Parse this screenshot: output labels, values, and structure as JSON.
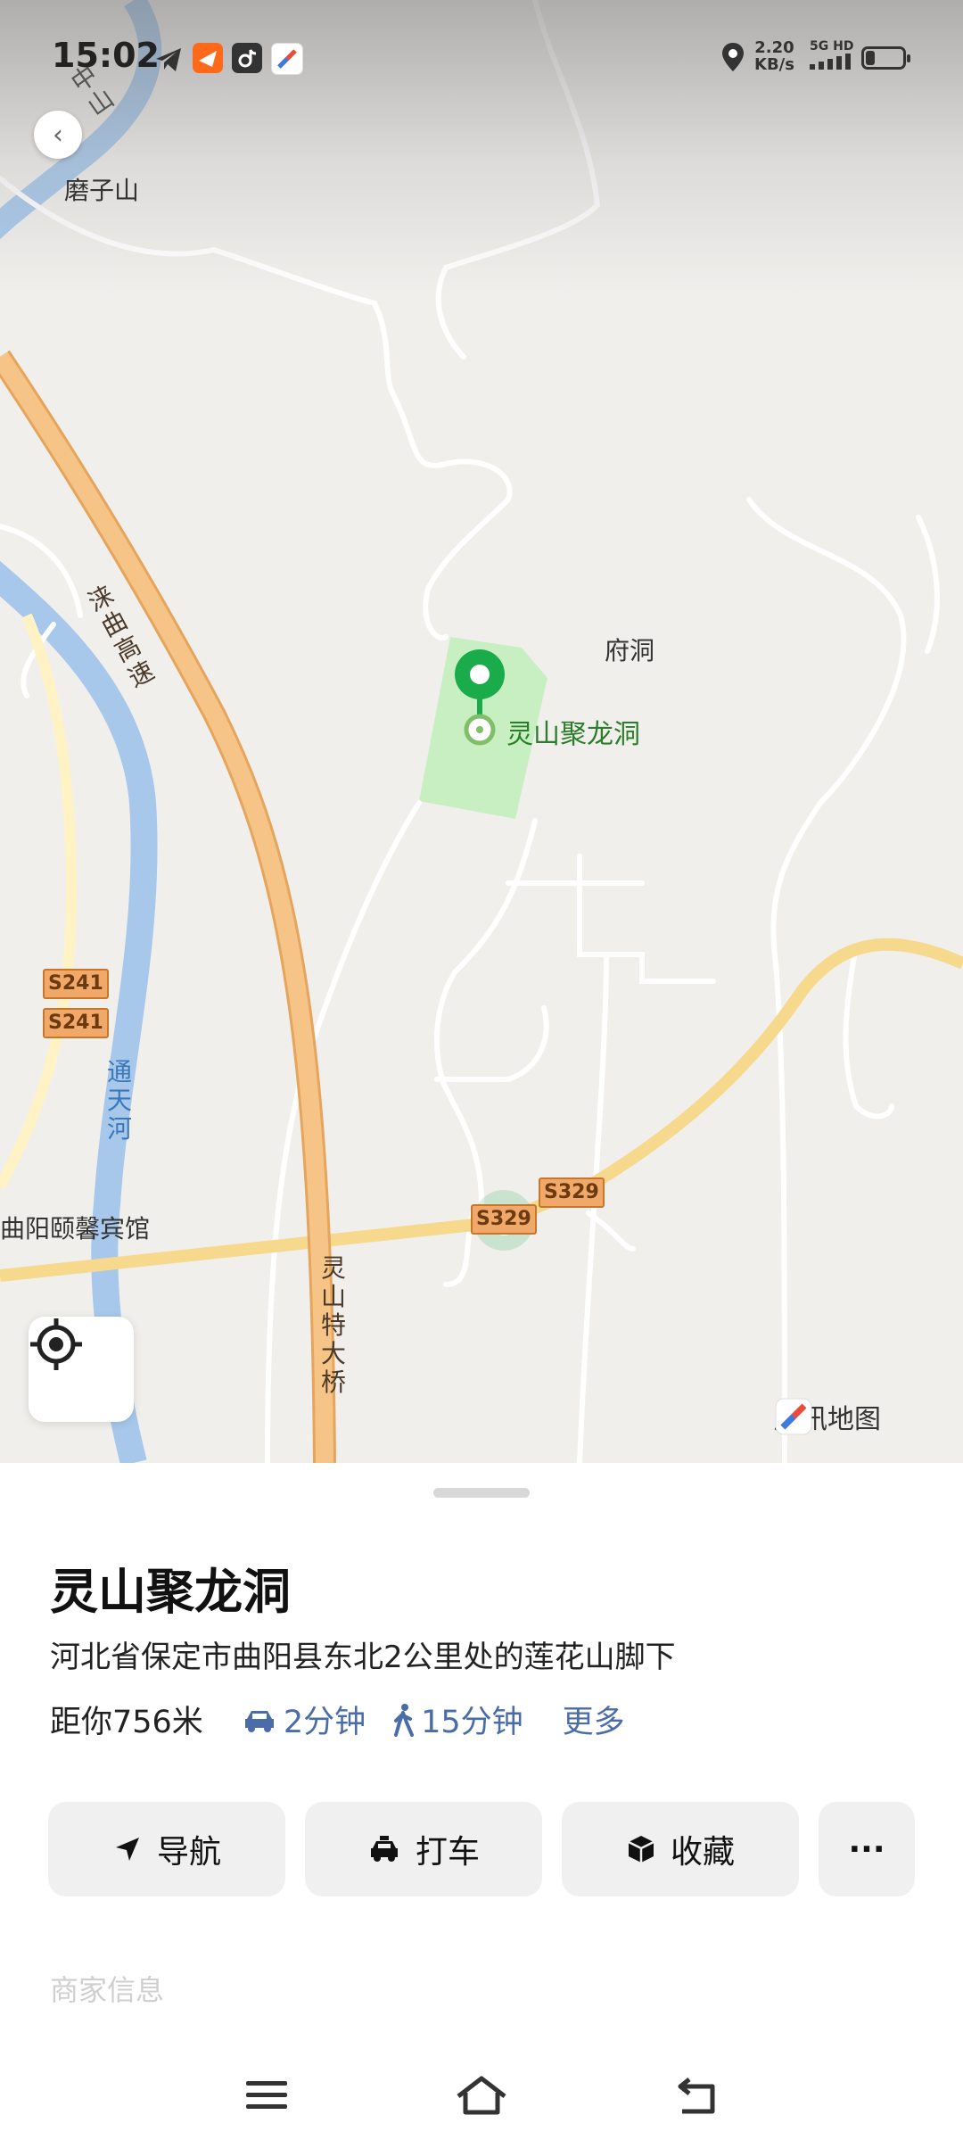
{
  "status_bar": {
    "time": "15:02",
    "speed_value": "2.20",
    "speed_unit": "KB/s",
    "network": "5G HD",
    "battery_level": 0.25
  },
  "map": {
    "labels": {
      "mozishan": "磨子山",
      "fudong": "府洞",
      "poi": "灵山聚龙洞",
      "hotel": "曲阳颐馨宾馆",
      "expressway": "涞曲高速",
      "river": "通天河",
      "bridge": "灵山特大桥",
      "road_top": "中山"
    },
    "shields": {
      "s241_a": "S241",
      "s241_b": "S241",
      "s329_a": "S329",
      "s329_b": "S329"
    },
    "watermark": "腾讯地图"
  },
  "place": {
    "name": "灵山聚龙洞",
    "address": "河北省保定市曲阳县东北2公里处的莲花山脚下",
    "distance": "距你756米",
    "drive_time": "2分钟",
    "walk_time": "15分钟",
    "more": "更多"
  },
  "actions": {
    "navigate": "导航",
    "taxi": "打车",
    "favorite": "收藏",
    "more": "···"
  },
  "section_hint": "商家信息",
  "colors": {
    "accent": "#1aab4b",
    "link": "#4a6ca8",
    "expressway": "#f5c486",
    "river": "#a7c8eb",
    "park": "#c8efc2"
  }
}
